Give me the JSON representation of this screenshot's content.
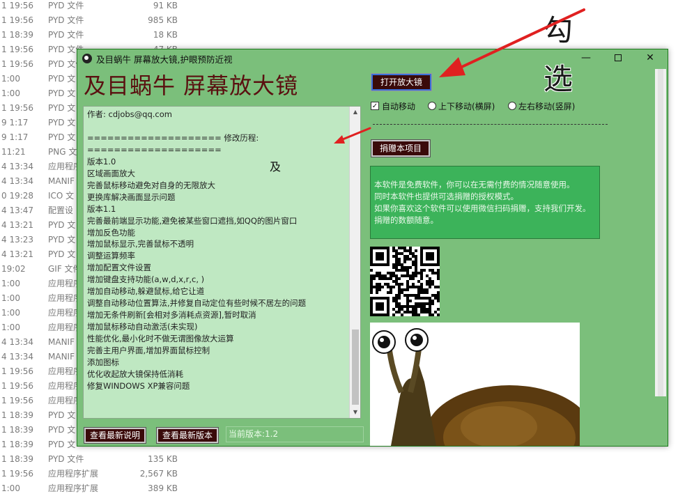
{
  "explorer": {
    "rows": [
      {
        "date": "1 19:56",
        "type": "PYD 文件",
        "size": "91 KB"
      },
      {
        "date": "1 19:56",
        "type": "PYD 文件",
        "size": "985 KB"
      },
      {
        "date": "1 18:39",
        "type": "PYD 文件",
        "size": "18 KB"
      },
      {
        "date": "1 19:56",
        "type": "PYD 文件",
        "size": "47 KB"
      },
      {
        "date": "1 19:56",
        "type": "PYD 文件",
        "size": ""
      },
      {
        "date": "1:00",
        "type": "PYD 文",
        "size": ""
      },
      {
        "date": "1:00",
        "type": "PYD 文",
        "size": ""
      },
      {
        "date": "1 19:56",
        "type": "PYD 文",
        "size": ""
      },
      {
        "date": "9 1:17",
        "type": "PYD 文",
        "size": ""
      },
      {
        "date": "9 1:17",
        "type": "PYD 文",
        "size": ""
      },
      {
        "date": "11:21",
        "type": "PNG 文",
        "size": ""
      },
      {
        "date": "4 13:34",
        "type": "应用程序",
        "size": ""
      },
      {
        "date": "4 13:34",
        "type": "MANIF",
        "size": ""
      },
      {
        "date": "0 19:28",
        "type": "ICO 文",
        "size": ""
      },
      {
        "date": "4 13:47",
        "type": "配置设",
        "size": ""
      },
      {
        "date": "4 13:21",
        "type": "PYD 文",
        "size": ""
      },
      {
        "date": "4 13:23",
        "type": "PYD 文",
        "size": ""
      },
      {
        "date": "4 13:21",
        "type": "PYD 文",
        "size": ""
      },
      {
        "date": "19:02",
        "type": "GIF 文件",
        "size": ""
      },
      {
        "date": "1:00",
        "type": "应用程序",
        "size": ""
      },
      {
        "date": "1:00",
        "type": "应用程序",
        "size": ""
      },
      {
        "date": "1:00",
        "type": "应用程序",
        "size": ""
      },
      {
        "date": "1:00",
        "type": "应用程序",
        "size": ""
      },
      {
        "date": "4 13:34",
        "type": "MANIF",
        "size": ""
      },
      {
        "date": "4 13:34",
        "type": "MANIF",
        "size": ""
      },
      {
        "date": "1 19:56",
        "type": "应用程序",
        "size": ""
      },
      {
        "date": "1 19:56",
        "type": "应用程序",
        "size": ""
      },
      {
        "date": "1 19:56",
        "type": "应用程序",
        "size": ""
      },
      {
        "date": "1 18:39",
        "type": "PYD 文",
        "size": ""
      },
      {
        "date": "1 18:39",
        "type": "PYD 文",
        "size": ""
      },
      {
        "date": "1 18:39",
        "type": "PYD 文",
        "size": ""
      },
      {
        "date": "1 18:39",
        "type": "PYD 文件",
        "size": "135 KB"
      },
      {
        "date": "1 19:56",
        "type": "应用程序扩展",
        "size": "2,567 KB"
      },
      {
        "date": "1:00",
        "type": "应用程序扩展",
        "size": "389 KB"
      }
    ]
  },
  "annotation": {
    "char1": "勾",
    "char2": "选"
  },
  "window": {
    "title": "及目蜗牛 屏幕放大镜,护眼预防近视",
    "min": "—",
    "close": "✕"
  },
  "app": {
    "heading": "及目蜗牛  屏幕放大镜",
    "history_text": "作者: cdjobs@qq.com\n\n==================== 修改历程:\n====================\n版本1.0\n区域画面放大\n完善鼠标移动避免对自身的无限放大\n更换库解决画面显示问题\n版本1.1\n完善最前端显示功能,避免被某些窗口遮挡,如QQ的图片窗口\n增加反色功能\n增加鼠标显示,完善鼠标不透明\n调整运算频率\n增加配置文件设置\n增加键盘支持功能(a,w,d,x,r,c, )\n增加自动移动,躲避鼠标,给它让道\n调整自动移动位置算法,并修复自动定位有些时候不居左的问题\n增加无条件刷新[会相对多消耗点资源],暂时取消\n增加鼠标移动自动激活(未实现)\n性能优化,最小化时不做无谓图像放大运算\n完善主用户界面,增加界面鼠标控制\n添加图标\n优化收起放大镜保持低消耗\n修复WINDOWS XP兼容问题",
    "btn_latest_notes": "查看最新说明",
    "btn_latest_version": "查看最新版本",
    "version_label": "当前版本:1.2",
    "btn_open": "打开放大镜",
    "opt_auto_move": "自动移动",
    "opt_vertical": "上下移动(横屏)",
    "opt_horizontal": "左右移动(竖屏)",
    "btn_donate": "捐赠本项目",
    "license_text": "本软件是免费软件，你可以在无需付费的情况随意使用。\n同时本软件也提供可选捐赠的授权模式。\n如果你喜欢这个软件可以使用微信扫码捐赠，支持我们开发。\n捐赠的数额随意。",
    "snail_char": "及"
  },
  "colors": {
    "window_bg": "#7bbf7b",
    "heading": "#5a1010",
    "button_bg": "#3a0a0a",
    "license_bg": "#3cb35a",
    "arrow": "#e02020"
  }
}
